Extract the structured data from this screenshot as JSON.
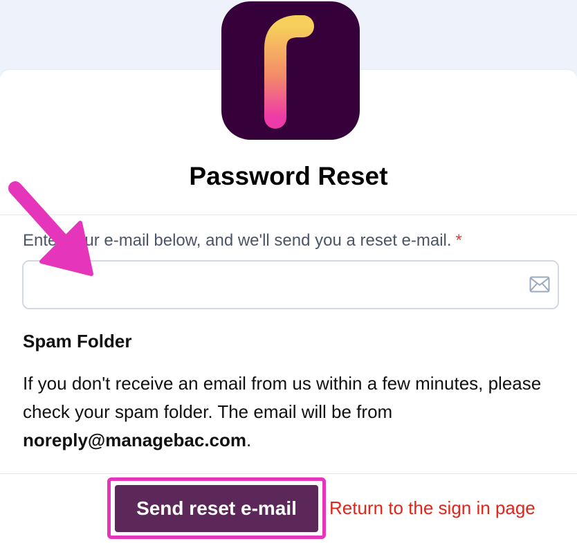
{
  "header": {
    "logo": {
      "icon": "f-logo-icon",
      "background": "#36003a"
    },
    "title": "Password Reset"
  },
  "form": {
    "email_label": "Enter your e-mail below, and we'll send you a reset e-mail.",
    "required_marker": "*",
    "email_value": "",
    "email_placeholder": "",
    "email_icon": "envelope-icon"
  },
  "spam": {
    "heading": "Spam Folder",
    "text_before": "If you don't receive an email from us within a few minutes, please check your spam folder. The email will be from ",
    "sender": "noreply@managebac.com",
    "text_after": "."
  },
  "actions": {
    "send_label": "Send reset e-mail",
    "return_label": "Return to the sign in page"
  },
  "annotations": {
    "arrow_icon": "pointer-arrow-icon",
    "highlight_color": "#e535ba"
  },
  "colors": {
    "button_bg": "#5c2859",
    "link": "#e0261b",
    "required": "#d64545"
  }
}
